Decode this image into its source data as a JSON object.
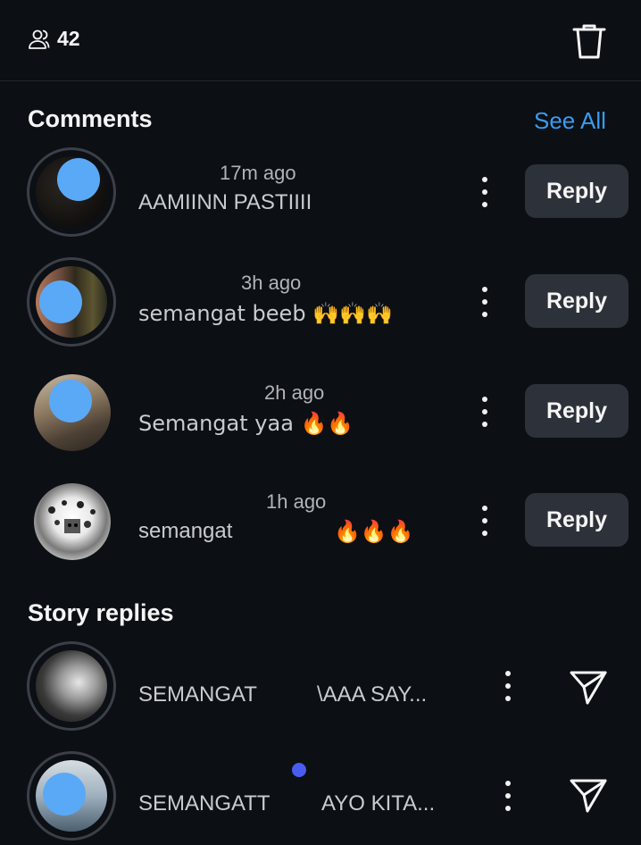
{
  "header": {
    "viewer_icon": "people-icon",
    "viewer_count": "42",
    "delete_icon": "trash-icon"
  },
  "comments": {
    "title": "Comments",
    "see_all": "See All",
    "items": [
      {
        "time": "17m ago",
        "text": "AAMIINN PASTIIII",
        "reply_label": "Reply"
      },
      {
        "time": "3h ago",
        "text": "semangat beeb 🙌🙌🙌",
        "reply_label": "Reply"
      },
      {
        "time": "2h ago",
        "text": "Semangat yaa 🔥🔥",
        "reply_label": "Reply"
      },
      {
        "time": "1h ago",
        "text": "semangat",
        "emoji": "🔥🔥🔥",
        "reply_label": "Reply"
      }
    ]
  },
  "story_replies": {
    "title": "Story replies",
    "items": [
      {
        "text_a": "SEMANGAT",
        "text_b": "\\AAA SAY..."
      },
      {
        "text_a": "SEMANGATT",
        "text_b": "AYO KITA..."
      }
    ]
  },
  "colors": {
    "background": "#0c0f14",
    "accent_link": "#3a9bf0",
    "button_bg": "#2d3139",
    "unread_dot": "#4a5cf0"
  }
}
